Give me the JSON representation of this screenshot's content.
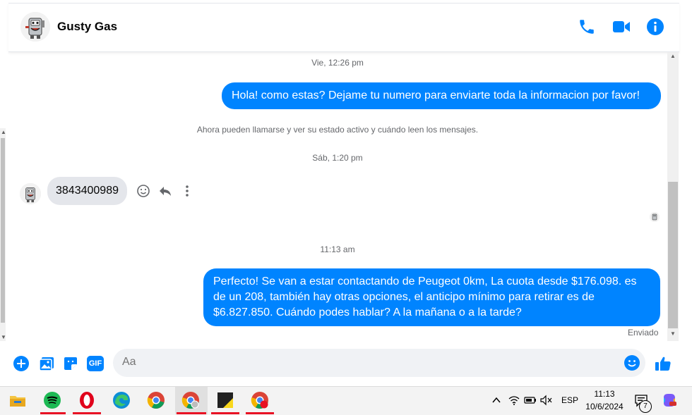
{
  "header": {
    "contact_name": "Gusty Gas"
  },
  "messages": {
    "ts1": "Vie, 12:26 pm",
    "out1": "Hola! como estas? Dejame tu numero para enviarte toda la informacion por favor!",
    "system_notice": "Ahora pueden llamarse y ver su estado activo y cuándo leen los mensajes.",
    "ts2": "Sáb, 1:20 pm",
    "in1": "3843400989",
    "ts3": "11:13 am",
    "out2": "Perfecto!  Se van a estar contactando de Peugeot 0km, La cuota desde $176.098. es de un 208, también hay otras opciones, el anticipo mínimo para retirar es de $6.827.850. Cuándo podes hablar? A la mañana o a la tarde?",
    "status": "Enviado"
  },
  "composer": {
    "placeholder": "Aa",
    "gif_label": "GIF"
  },
  "taskbar": {
    "lang": "ESP",
    "time": "11:13",
    "date": "10/6/2024",
    "notification_count": "7"
  },
  "colors": {
    "accent": "#0084ff",
    "bubble_in": "#e4e6eb"
  }
}
